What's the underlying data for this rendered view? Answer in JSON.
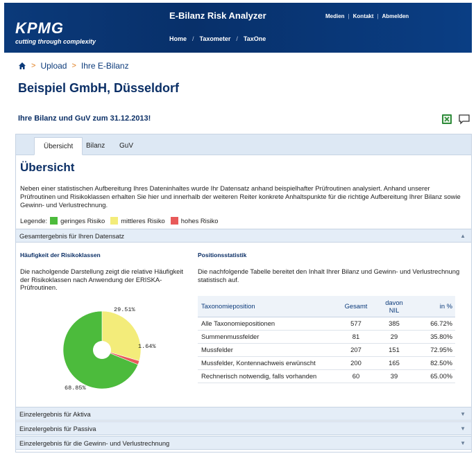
{
  "header": {
    "logo": "KPMG",
    "tagline": "cutting through complexity",
    "app_title": "E-Bilanz Risk Analyzer",
    "top_links": [
      "Medien",
      "Kontakt",
      "Abmelden"
    ],
    "nav": [
      "Home",
      "Taxometer",
      "TaxOne"
    ]
  },
  "breadcrumb": [
    "Upload",
    "Ihre E-Bilanz"
  ],
  "page_title": "Beispiel GmbH, Düsseldorf",
  "subtitle": "Ihre Bilanz und GuV zum 31.12.2013!",
  "tabs": [
    "Übersicht",
    "Bilanz",
    "GuV"
  ],
  "section_title": "Übersicht",
  "intro": "Neben einer statistischen Aufbereitung Ihres Dateninhaltes wurde Ihr Datensatz anhand beispielhafter Prüfroutinen analysiert. Anhand unserer Prüfroutinen und Risikoklassen erhalten Sie hier und innerhalb der weiteren Reiter konkrete Anhaltspunkte für die richtige Aufbereitung Ihrer Bilanz sowie Gewinn- und Verlustrechnung.",
  "legend": {
    "label": "Legende:",
    "items": [
      {
        "label": "geringes Risiko",
        "color": "#4cbb3c"
      },
      {
        "label": "mittleres Risiko",
        "color": "#f3ec7a"
      },
      {
        "label": "hohes Risiko",
        "color": "#e85a5a"
      }
    ]
  },
  "accordions": {
    "overall": "Gesamtergebnis für Ihren Datensatz",
    "aktiva": "Einzelergebnis für Aktiva",
    "passiva": "Einzelergebnis für Passiva",
    "guv": "Einzelergebnis für die Gewinn- und Verlustrechnung"
  },
  "left_col": {
    "heading": "Häufigkeit der Risikoklassen",
    "text": "Die nacholgende Darstellung zeigt die relative Häufigkeit der Risikoklassen nach Anwendung der ERISKA-Prüfroutinen."
  },
  "right_col": {
    "heading": "Positionsstatistik",
    "text": "Die nachfolgende Tabelle bereitet den Inhalt Ihrer Bilanz und Gewinn- und Verlustrechnung statistisch auf."
  },
  "chart_data": {
    "type": "pie",
    "categories": [
      "geringes Risiko",
      "mittleres Risiko",
      "hohes Risiko"
    ],
    "values": [
      68.85,
      29.51,
      1.64
    ],
    "labels": [
      "68.85%",
      "29.51%",
      "1.64%"
    ],
    "colors": [
      "#4cbb3c",
      "#f3ec7a",
      "#e85a5a"
    ],
    "title": "",
    "donut": true
  },
  "table": {
    "columns": [
      "Taxonomieposition",
      "Gesamt",
      "davon NIL",
      "in %"
    ],
    "rows": [
      [
        "Alle Taxonomiepositionen",
        "577",
        "385",
        "66.72%"
      ],
      [
        "Summenmussfelder",
        "81",
        "29",
        "35.80%"
      ],
      [
        "Mussfelder",
        "207",
        "151",
        "72.95%"
      ],
      [
        "Mussfelder, Kontennachweis erwünscht",
        "200",
        "165",
        "82.50%"
      ],
      [
        "Rechnerisch notwendig, falls vorhanden",
        "60",
        "39",
        "65.00%"
      ]
    ]
  }
}
